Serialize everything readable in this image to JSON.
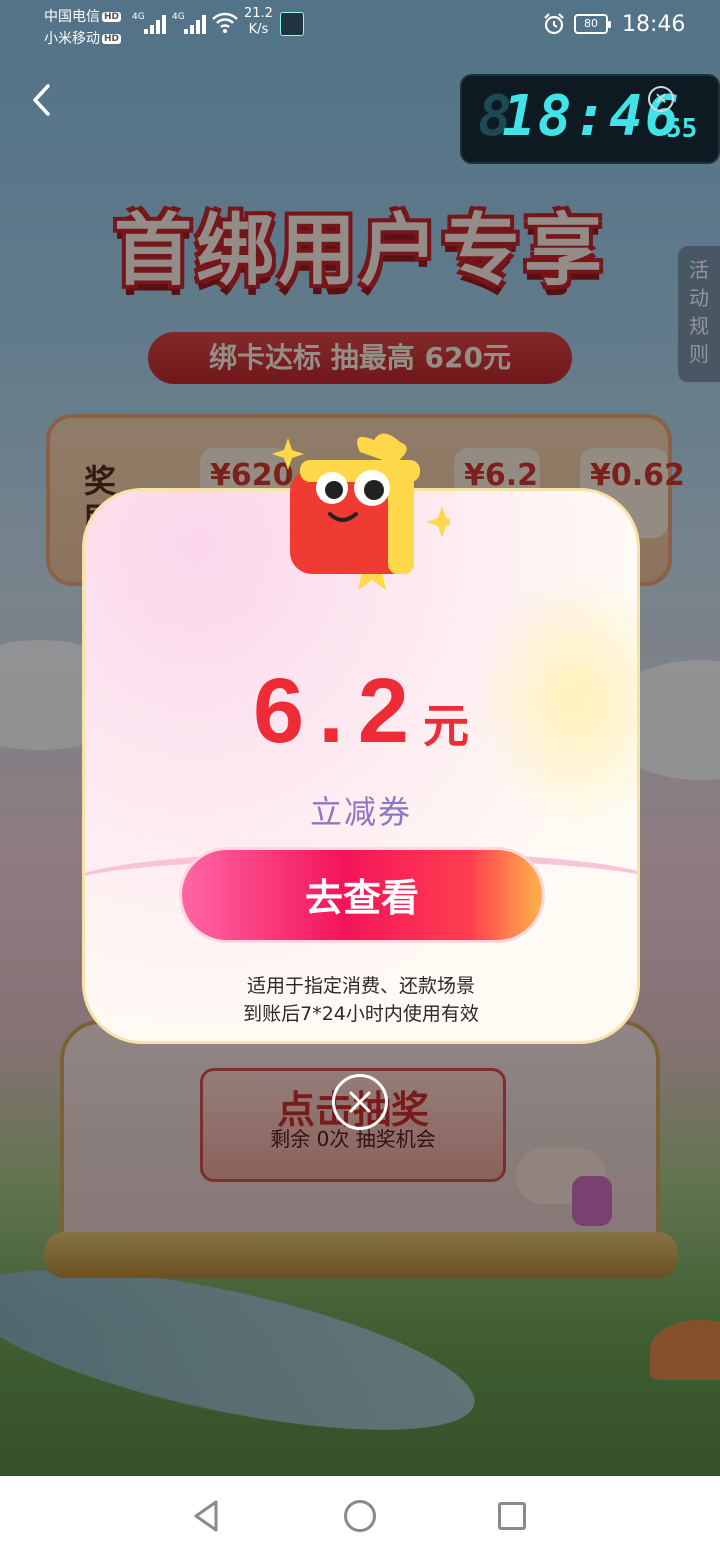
{
  "status_bar": {
    "carrier_1": "中国电信",
    "carrier_2": "小米移动",
    "hd_badge": "HD",
    "network_1": "4G",
    "network_2": "4G",
    "speed_value": "21.2",
    "speed_unit": "K/s",
    "battery": "80",
    "time": "18:46",
    "icons": [
      "signal-icon",
      "wifi-icon",
      "alarm-icon",
      "battery-icon"
    ]
  },
  "floating_clock": {
    "ghost_digit": "8",
    "time": "18:46",
    "seconds": "55"
  },
  "page": {
    "title": "首绑用户专享",
    "subtitle": "绑卡达标 抽最高 620元",
    "side_tab": "活动规则",
    "rewards_label": "奖励",
    "rewards": [
      "¥620",
      "¥6.2",
      "¥0.62"
    ],
    "draw_button_title": "点击抽奖",
    "draw_count_text": "剩余 0次 抽奖机会"
  },
  "modal": {
    "amount": "6.2",
    "unit": "元",
    "coupon_type": "立减券",
    "action_label": "去查看",
    "note_line_1": "适用于指定消费、还款场景",
    "note_line_2": "到账后7*24小时内使用有效"
  },
  "colors": {
    "amount_red": "#ee2b37",
    "coupon_purple": "#8f76c7",
    "button_pink": "#f3145a",
    "clock_cyan": "#3fe3e8"
  }
}
